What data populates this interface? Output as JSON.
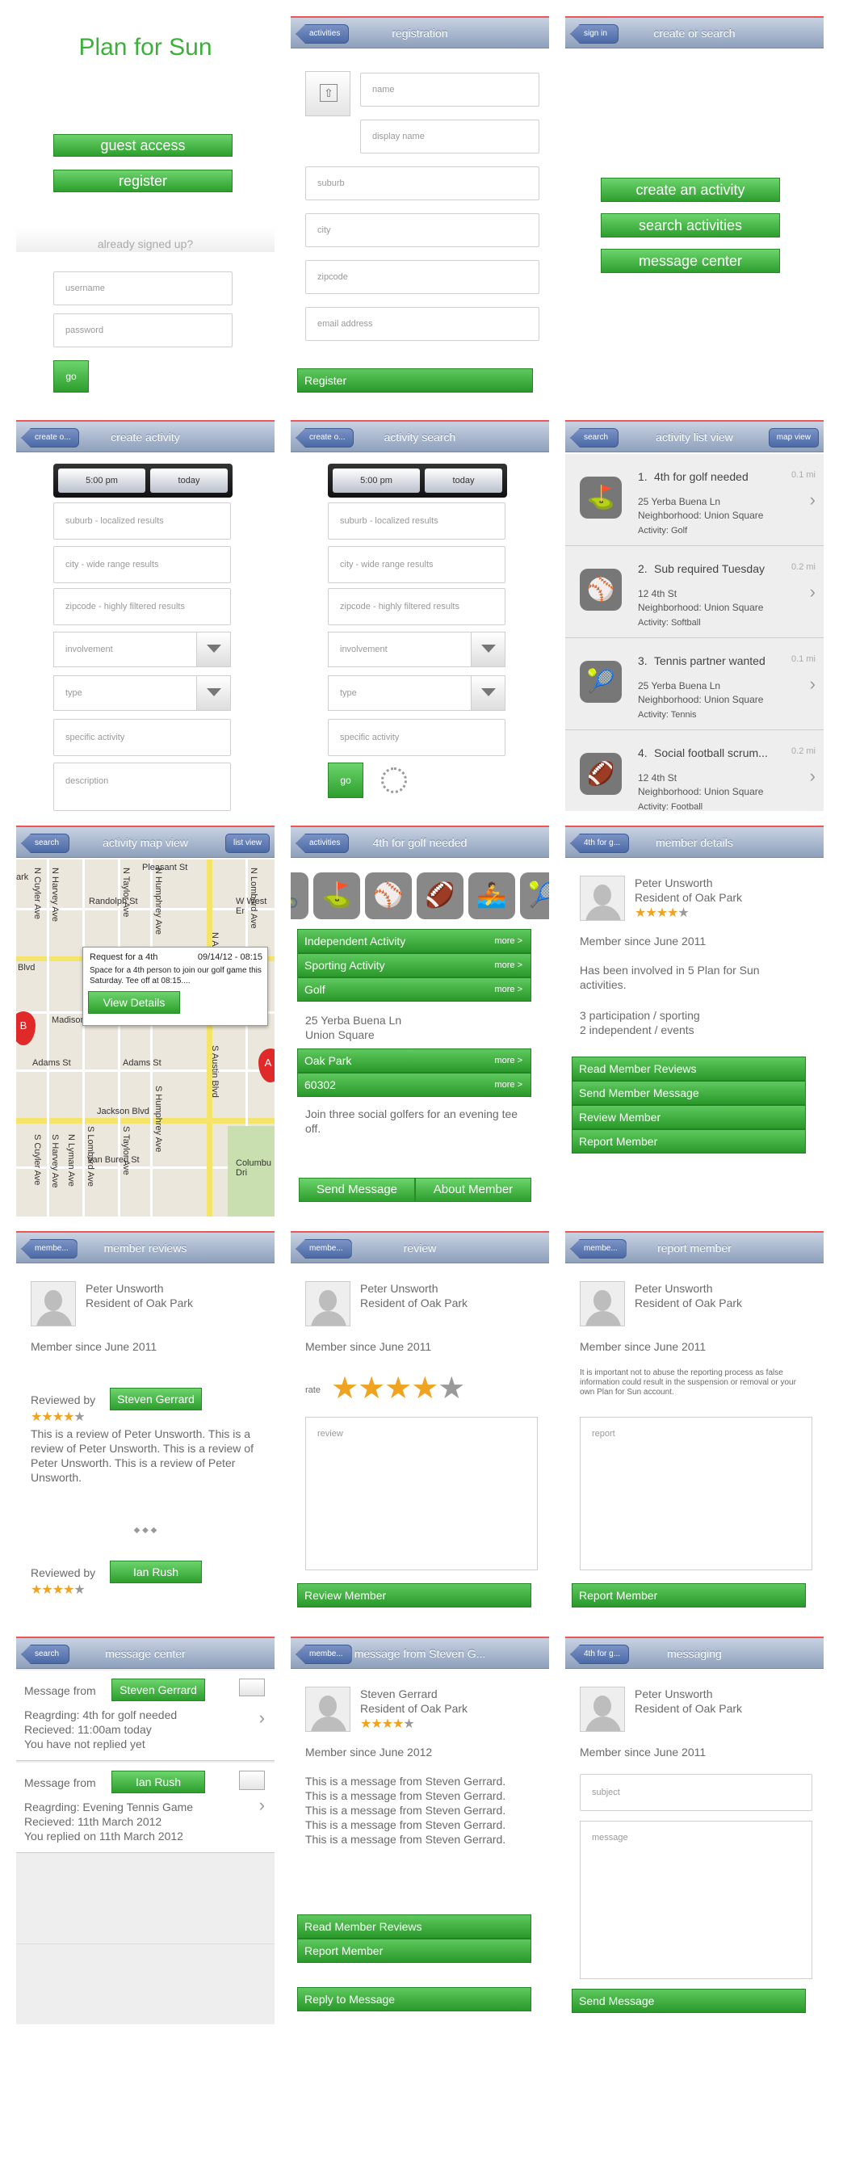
{
  "s1": {
    "logo": "Plan for Sun",
    "guest": "guest access",
    "register": "register",
    "already": "already signed up?",
    "username": "username",
    "password": "password",
    "go": "go"
  },
  "s2": {
    "back": "activities",
    "title": "registration",
    "name": "name",
    "display": "display name",
    "suburb": "suburb",
    "city": "city",
    "zip": "zipcode",
    "email": "email address",
    "btn": "Register"
  },
  "s3": {
    "back": "sign in",
    "title": "create or search",
    "b1": "create an activity",
    "b2": "search activities",
    "b3": "message center"
  },
  "s4": {
    "back": "create o...",
    "title": "create activity",
    "time": "5:00 pm",
    "day": "today",
    "suburb": "suburb - localized results",
    "city": "city - wide range results",
    "zip": "zipcode - highly filtered results",
    "involvement": "involvement",
    "type": "type",
    "specific": "specific activity",
    "description": "description"
  },
  "s5": {
    "back": "create o...",
    "title": "activity search",
    "time": "5:00 pm",
    "day": "today",
    "suburb": "suburb - localized results",
    "city": "city - wide range results",
    "zip": "zipcode - highly filtered results",
    "involvement": "involvement",
    "type": "type",
    "specific": "specific activity",
    "go": "go"
  },
  "s6": {
    "back": "search",
    "title": "activity list view",
    "right": "map view",
    "items": [
      {
        "num": "1.",
        "title": "4th for golf needed",
        "dist": "0.1 mi",
        "addr": "25 Yerba Buena Ln",
        "hood": "Neighborhood:  Union Square",
        "act": "Activity: Golf",
        "icon": "⛳"
      },
      {
        "num": "2.",
        "title": "Sub required Tuesday",
        "dist": "0.2 mi",
        "addr": "12 4th St",
        "hood": "Neighborhood:  Union Square",
        "act": "Activity: Softball",
        "icon": "⚾"
      },
      {
        "num": "3.",
        "title": "Tennis partner wanted",
        "dist": "0.1 mi",
        "addr": "25 Yerba Buena Ln",
        "hood": "Neighborhood:  Union Square",
        "act": "Activity: Tennis",
        "icon": "🎾"
      },
      {
        "num": "4.",
        "title": "Social football scrum...",
        "dist": "0.2 mi",
        "addr": "12 4th St",
        "hood": "Neighborhood:  Union Square",
        "act": "Activity: Football",
        "icon": "🏈"
      }
    ]
  },
  "s7": {
    "back": "search",
    "title": "activity map view",
    "right": "list view",
    "popup_title": "Request for a 4th",
    "popup_date": "09/14/12 - 08:15",
    "popup_text": "Space for a 4th person to join our golf game this Saturday. Tee off at 08:15....",
    "details": "View Details",
    "pinA": "A",
    "pinB": "B",
    "streets": [
      "Pleasant St",
      "Randolph St",
      "W West Er",
      "Blvd",
      "Madison",
      "Adams St",
      "Adams St",
      "Jackson Blvd",
      "Van Buren St",
      "Columbu Dri",
      "N Austin Blvd",
      "S Austin Blvd",
      "N Humphrey Ave",
      "S Humphrey Ave",
      "N Taylor Ave",
      "S Taylor Ave",
      "N Lombard Ave",
      "S Lombard Ave",
      "N Cuyler Ave",
      "S Cuyler Ave",
      "N Harvey Ave",
      "S Harvey Ave",
      "N Lyman Ave",
      "ark"
    ]
  },
  "s8": {
    "back": "activities",
    "title": "4th for golf needed",
    "rows": [
      {
        "label": "Independent Activity",
        "more": "more >"
      },
      {
        "label": "Sporting Activity",
        "more": "more >"
      },
      {
        "label": "Golf",
        "more": "more >"
      }
    ],
    "addr1": "25 Yerba Buena Ln",
    "addr2": "Union Square",
    "rows2": [
      {
        "label": "Oak Park",
        "more": "more >"
      },
      {
        "label": "60302",
        "more": "more >"
      }
    ],
    "desc": "Join three social golfers for an evening tee off.",
    "send": "Send Message",
    "about": "About Member"
  },
  "s9": {
    "back": "4th for g...",
    "title": "member details",
    "name": "Peter Unsworth",
    "res": "Resident of Oak Park",
    "since": "Member since June 2011",
    "p1": "Has been involved in 5 Plan for Sun activities.",
    "p2": "3 participation / sporting",
    "p3": "2 independent / events",
    "b1": "Read Member Reviews",
    "b2": "Send Member Message",
    "b3": "Review Member",
    "b4": "Report Member"
  },
  "s10": {
    "back": "membe...",
    "title": "member reviews",
    "name": "Peter Unsworth",
    "res": "Resident of Oak Park",
    "since": "Member since June 2011",
    "by": "Reviewed by",
    "r1": "Steven Gerrard",
    "text": "This is a review of Peter Unsworth. This is a review of Peter Unsworth. This is a review of Peter Unsworth. This is a review of Peter Unsworth.",
    "dots": "◆ ◆ ◆",
    "r2": "Ian Rush"
  },
  "s11": {
    "back": "membe...",
    "title": "review",
    "name": "Peter Unsworth",
    "res": "Resident of Oak Park",
    "since": "Member since June 2011",
    "rate": "rate",
    "review": "review",
    "btn": "Review Member"
  },
  "s12": {
    "back": "membe...",
    "title": "report member",
    "name": "Peter Unsworth",
    "res": "Resident of Oak Park",
    "since": "Member since June 2011",
    "note": "It is important not to abuse the reporting process as false information could result in the suspension or removal or your own Plan for Sun account.",
    "report": "report",
    "btn": "Report Member"
  },
  "s13": {
    "back": "search",
    "title": "message center",
    "m1from": "Message from",
    "m1who": "Steven Gerrard",
    "m1a": "Reagrding: 4th for golf needed",
    "m1b": "Recieved: 11:00am today",
    "m1c": "You have not replied yet",
    "m2from": "Message from",
    "m2who": "Ian Rush",
    "m2a": "Reagrding: Evening Tennis Game",
    "m2b": "Recieved: 11th March 2012",
    "m2c": "You replied on 11th March 2012"
  },
  "s14": {
    "back": "membe...",
    "title": "message from Steven G...",
    "name": "Steven Gerrard",
    "res": "Resident of Oak Park",
    "since": "Member since June 2012",
    "msg": "This is a message from Steven Gerrard. This is a message from Steven Gerrard. This is a message from Steven Gerrard. This is a message from Steven Gerrard. This is a message from Steven Gerrard.",
    "b1": "Read Member Reviews",
    "b2": "Report Member",
    "b3": "Reply to Message"
  },
  "s15": {
    "back": "4th for g...",
    "title": "messaging",
    "name": "Peter Unsworth",
    "res": "Resident of Oak Park",
    "since": "Member since June 2011",
    "subject": "subject",
    "message": "message",
    "btn": "Send Message"
  }
}
